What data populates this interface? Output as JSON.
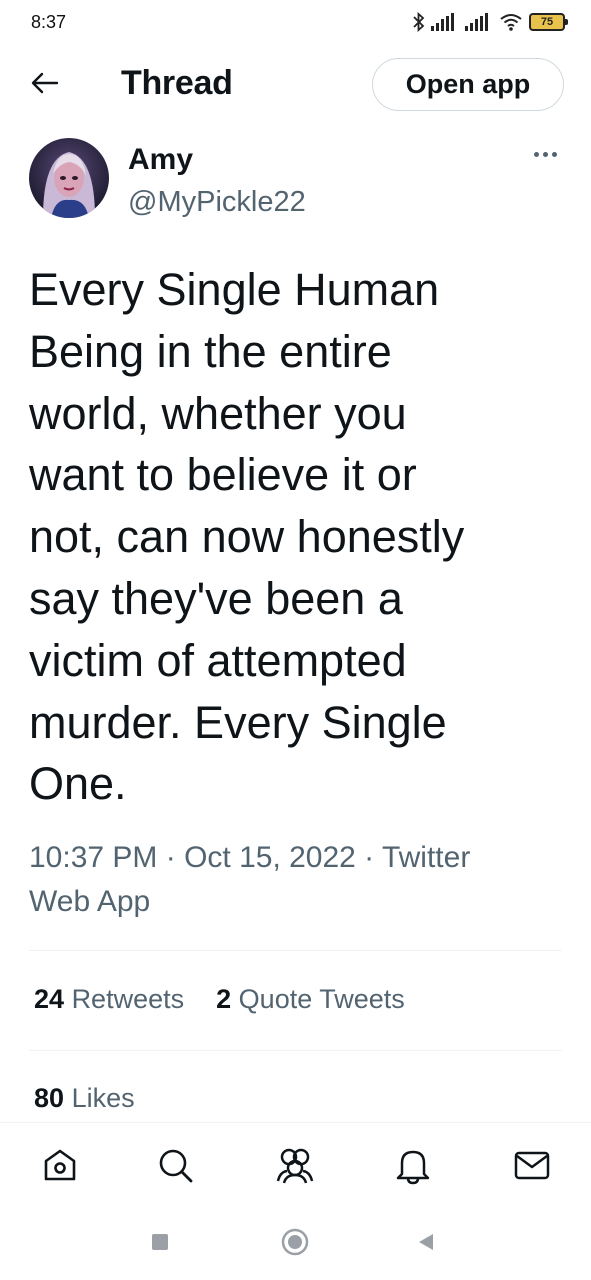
{
  "status_bar": {
    "time": "8:37",
    "battery_level": "75",
    "icons": [
      "bluetooth-icon",
      "signal-icon",
      "signal-icon",
      "wifi-icon",
      "battery-icon"
    ]
  },
  "header": {
    "back_icon": "arrow-left-icon",
    "title": "Thread",
    "open_app_label": "Open app"
  },
  "tweet": {
    "author_name": "Amy",
    "author_handle": "@MyPickle22",
    "more_icon": "more-horizontal-icon",
    "text": "Every Single Human\nBeing in the entire\nworld, whether you\nwant to believe it or\nnot, can now honestly\nsay they've been a\nvictim of attempted\nmurder. Every Single\nOne.",
    "meta_line1": "10:37 PM · Oct 15, 2022 · Twitter",
    "meta_line2": "Web App",
    "retweets_count": "24",
    "retweets_label": "Retweets",
    "quotes_count": "2",
    "quotes_label": "Quote Tweets",
    "likes_count": "80",
    "likes_label": "Likes"
  },
  "bottom_nav": [
    {
      "icon": "home-icon"
    },
    {
      "icon": "search-icon"
    },
    {
      "icon": "communities-icon"
    },
    {
      "icon": "notifications-bell-icon"
    },
    {
      "icon": "messages-envelope-icon"
    }
  ],
  "system_nav": [
    {
      "icon": "recents-square-icon"
    },
    {
      "icon": "home-circle-icon"
    },
    {
      "icon": "back-triangle-icon"
    }
  ],
  "colors": {
    "text_primary": "#0f1419",
    "text_secondary": "#536471",
    "divider": "#eff3f4",
    "battery_fill": "#e8c24a"
  }
}
